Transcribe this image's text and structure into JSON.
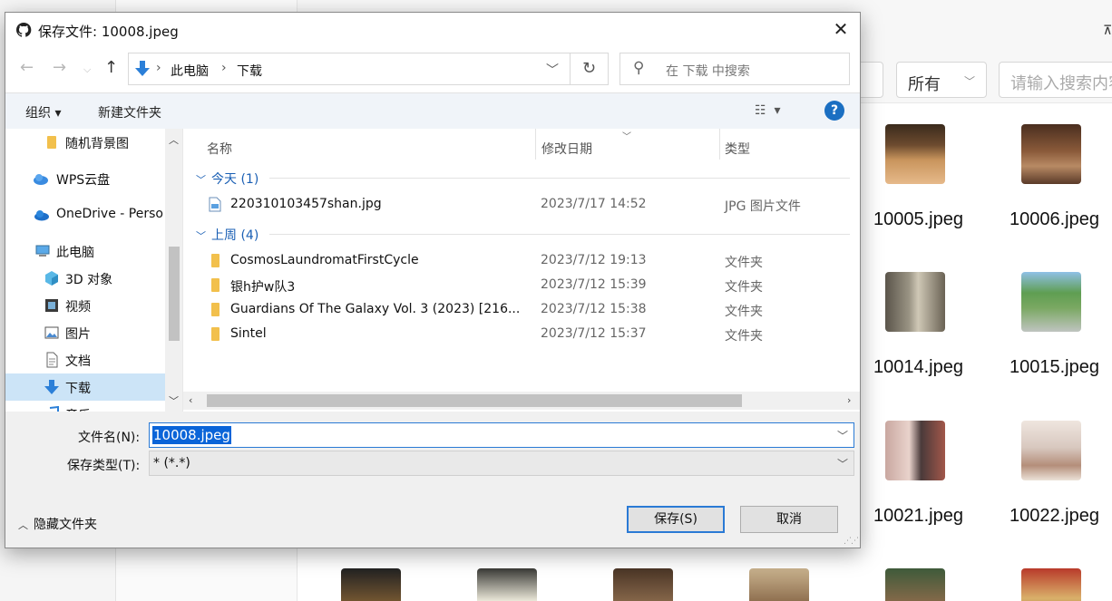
{
  "background": {
    "filter_label": "所有",
    "search_placeholder": "请输入搜索内容",
    "images": [
      {
        "name": "10005.jpeg",
        "color": "#b07a4a"
      },
      {
        "name": "10006.jpeg",
        "color": "#7a5036"
      },
      {
        "name": "10014.jpeg",
        "color": "#8e8a7c"
      },
      {
        "name": "10015.jpeg",
        "color": "#6f9a5a"
      },
      {
        "name": "10021.jpeg",
        "color": "#a8705c"
      },
      {
        "name": "10022.jpeg",
        "color": "#d9cfc7"
      }
    ]
  },
  "dialog": {
    "title": "保存文件: 10008.jpeg",
    "close_icon": "close-icon",
    "breadcrumb": [
      "此电脑",
      "下载"
    ],
    "search_placeholder": "在 下载 中搜索",
    "toolbar": {
      "organize": "组织 ▾",
      "new_folder": "新建文件夹",
      "help": "?"
    },
    "nav_tree": [
      {
        "label": "随机背景图",
        "icon": "folder-icon"
      },
      {
        "label": "WPS云盘",
        "icon": "cloud-icon"
      },
      {
        "label": "OneDrive - Perso",
        "icon": "onedrive-icon"
      },
      {
        "label": "此电脑",
        "icon": "computer-icon"
      },
      {
        "label": "3D 对象",
        "icon": "3d-objects-icon"
      },
      {
        "label": "视频",
        "icon": "video-icon"
      },
      {
        "label": "图片",
        "icon": "pictures-icon"
      },
      {
        "label": "文档",
        "icon": "documents-icon"
      },
      {
        "label": "下载",
        "icon": "download-icon",
        "selected": true
      },
      {
        "label": "音乐",
        "icon": "music-icon"
      }
    ],
    "columns": {
      "name": "名称",
      "date": "修改日期",
      "type": "类型"
    },
    "groups": [
      {
        "label": "今天 (1)",
        "files": [
          {
            "name": "220310103457shan.jpg",
            "date": "2023/7/17 14:52",
            "type": "JPG 图片文件",
            "icon": "image-file-icon"
          }
        ]
      },
      {
        "label": "上周 (4)",
        "files": [
          {
            "name": "CosmosLaundromatFirstCycle",
            "date": "2023/7/12 19:13",
            "type": "文件夹",
            "icon": "folder-icon"
          },
          {
            "name": "银h护w队3",
            "date": "2023/7/12 15:39",
            "type": "文件夹",
            "icon": "folder-icon"
          },
          {
            "name": "Guardians Of The Galaxy Vol. 3 (2023) [216...",
            "date": "2023/7/12 15:38",
            "type": "文件夹",
            "icon": "folder-icon"
          },
          {
            "name": "Sintel",
            "date": "2023/7/12 15:37",
            "type": "文件夹",
            "icon": "folder-icon"
          }
        ]
      }
    ],
    "filename_label": "文件名(N):",
    "filename_value": "10008.jpeg",
    "filetype_label": "保存类型(T):",
    "filetype_value": "* (*.*)",
    "hide_folders": "隐藏文件夹",
    "save_button": "保存(S)",
    "cancel_button": "取消"
  },
  "colors": {
    "accent": "#0a64d8",
    "selection": "#cce4f7",
    "group_header": "#1a5fb4"
  }
}
